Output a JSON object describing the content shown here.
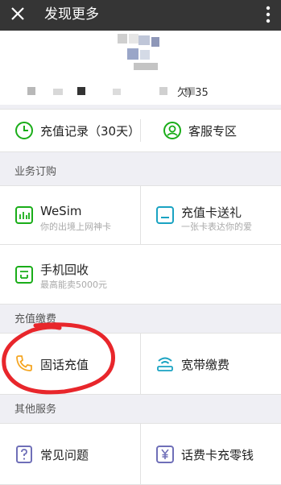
{
  "header": {
    "title": "发现更多"
  },
  "profile": {
    "sub_text": "欠) 35"
  },
  "quick": {
    "items": [
      {
        "label": "充值记录（30天）",
        "icon": "clock-icon"
      },
      {
        "label": "客服专区",
        "icon": "service-icon"
      }
    ]
  },
  "sections": [
    {
      "title": "业务订购",
      "items": [
        {
          "title": "WeSim",
          "subtitle": "你的出境上网神卡",
          "icon": "chart-card-icon"
        },
        {
          "title": "充值卡送礼",
          "subtitle": "一张卡表达你的爱",
          "icon": "gift-card-icon"
        },
        {
          "title": "手机回收",
          "subtitle": "最高能卖5000元",
          "icon": "recycle-phone-icon"
        }
      ]
    },
    {
      "title": "充值缴费",
      "items": [
        {
          "title": "固话充值",
          "icon": "phone-icon"
        },
        {
          "title": "宽带缴费",
          "icon": "wifi-icon"
        }
      ]
    },
    {
      "title": "其他服务",
      "items": [
        {
          "title": "常见问题",
          "icon": "question-icon"
        },
        {
          "title": "话费卡充零钱",
          "icon": "yen-card-icon"
        }
      ]
    }
  ],
  "colors": {
    "green": "#1aad19",
    "teal": "#1aa3c2",
    "orange": "#f5a623",
    "purple": "#6f6fb8",
    "annotation_red": "#e8262b"
  }
}
